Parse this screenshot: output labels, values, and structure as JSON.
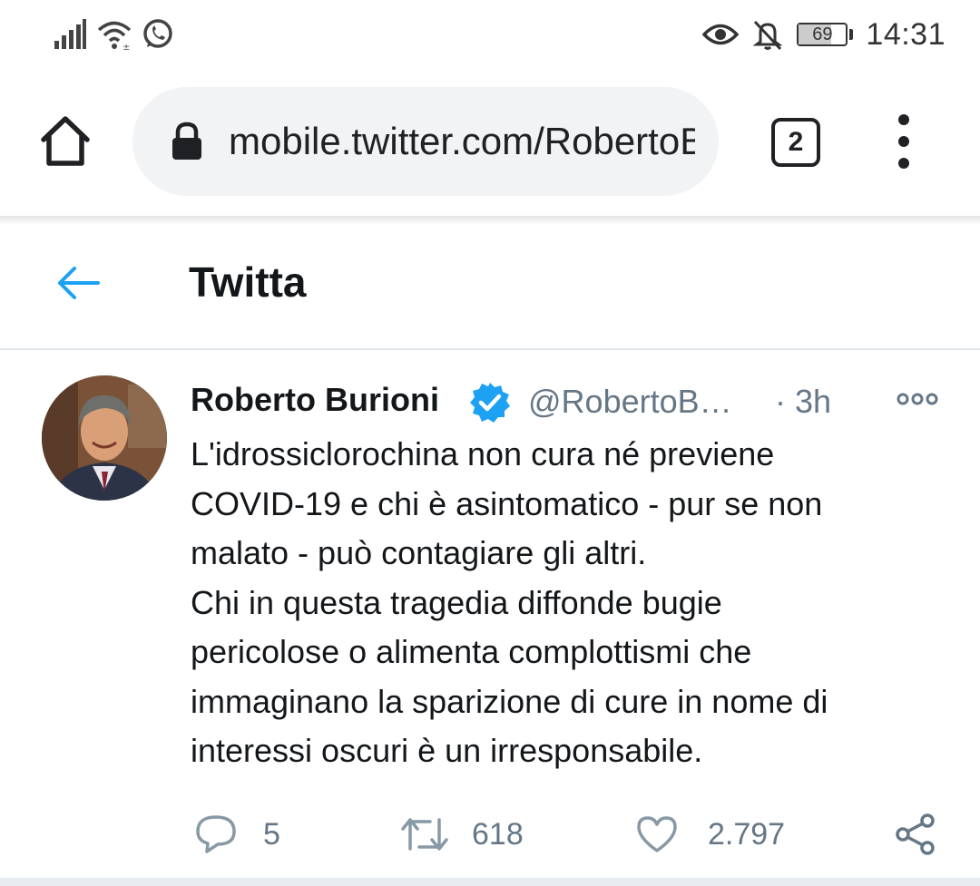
{
  "status_bar": {
    "time": "14:31",
    "battery_level": "69",
    "icons_left": [
      "signal-icon",
      "wifi-icon",
      "whatsapp-icon"
    ],
    "icons_right": [
      "eye-icon",
      "bell-off-icon",
      "battery-icon"
    ]
  },
  "browser": {
    "url": "mobile.twitter.com/RobertoBurioni",
    "tab_count": "2"
  },
  "page": {
    "title": "Twitta"
  },
  "tweet": {
    "author_name": "Roberto Burioni",
    "handle": "@RobertoB…",
    "time": "· 3h",
    "text_lines": [
      "L'idrossiclorochina non cura né previene",
      "COVID-19 e chi è asintomatico - pur se non",
      "malato - può contagiare gli altri.",
      "Chi in questa tragedia diffonde bugie",
      "pericolose o alimenta complottismi che",
      "immaginano la sparizione di cure in nome di",
      "interessi oscuri è un irresponsabile."
    ],
    "replies": "5",
    "retweets": "618",
    "likes": "2.797"
  },
  "colors": {
    "twitter_blue": "#1da1f2",
    "secondary_text": "#657786",
    "url_bar_bg": "#f1f3f4"
  }
}
